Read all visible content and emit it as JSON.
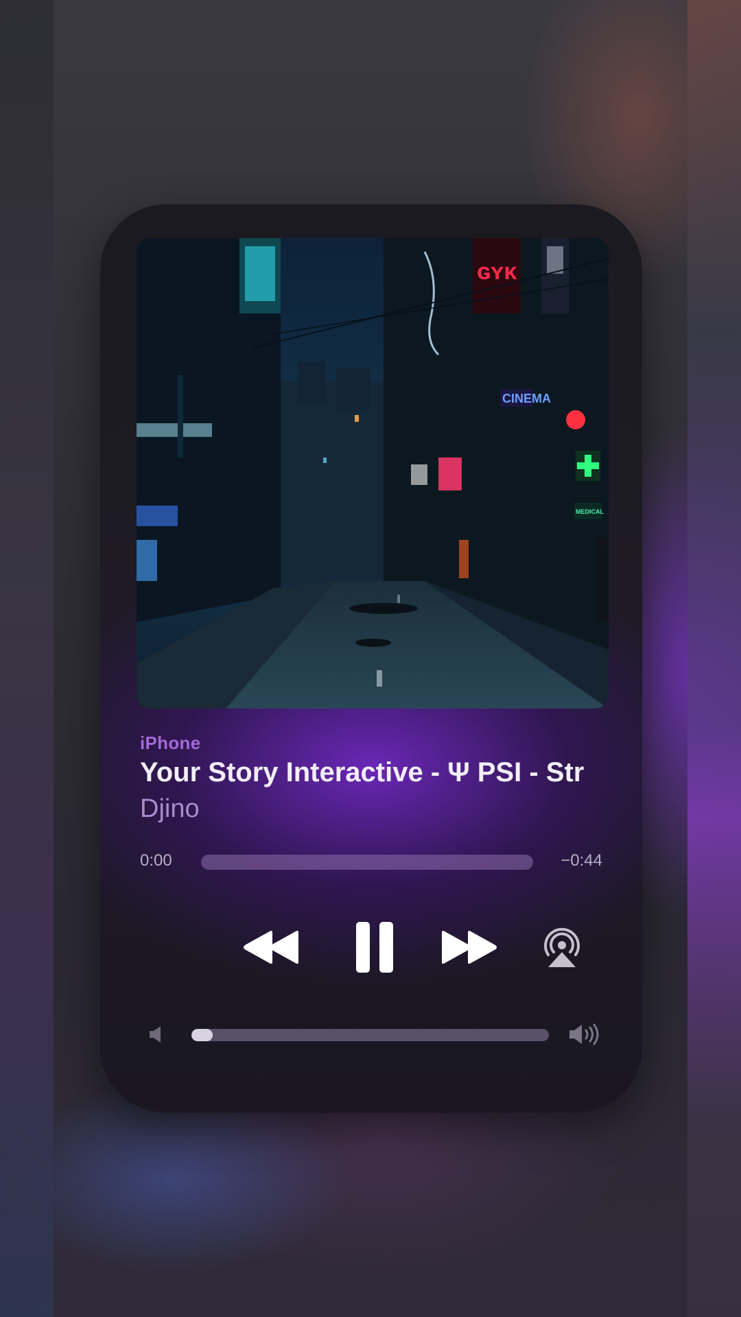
{
  "now_playing": {
    "device": "iPhone",
    "title": "Your Story Interactive - Ψ PSI -  Str",
    "artist": "Djino",
    "time_elapsed": "0:00",
    "time_remaining": "−0:44",
    "progress": 0.0,
    "volume": 0.06
  },
  "artwork": {
    "signs": {
      "cinema": "CINEMA",
      "medical": "MEDICAL"
    }
  },
  "icons": {
    "rewind": "backward-icon",
    "pause": "pause-icon",
    "forward": "forward-icon",
    "airplay": "airplay-audio-icon",
    "volume_low": "speaker-low-icon",
    "volume_high": "speaker-high-icon"
  },
  "colors": {
    "accent": "#a26ad8",
    "artist": "#a98ccb",
    "glow": "#6e28be"
  }
}
